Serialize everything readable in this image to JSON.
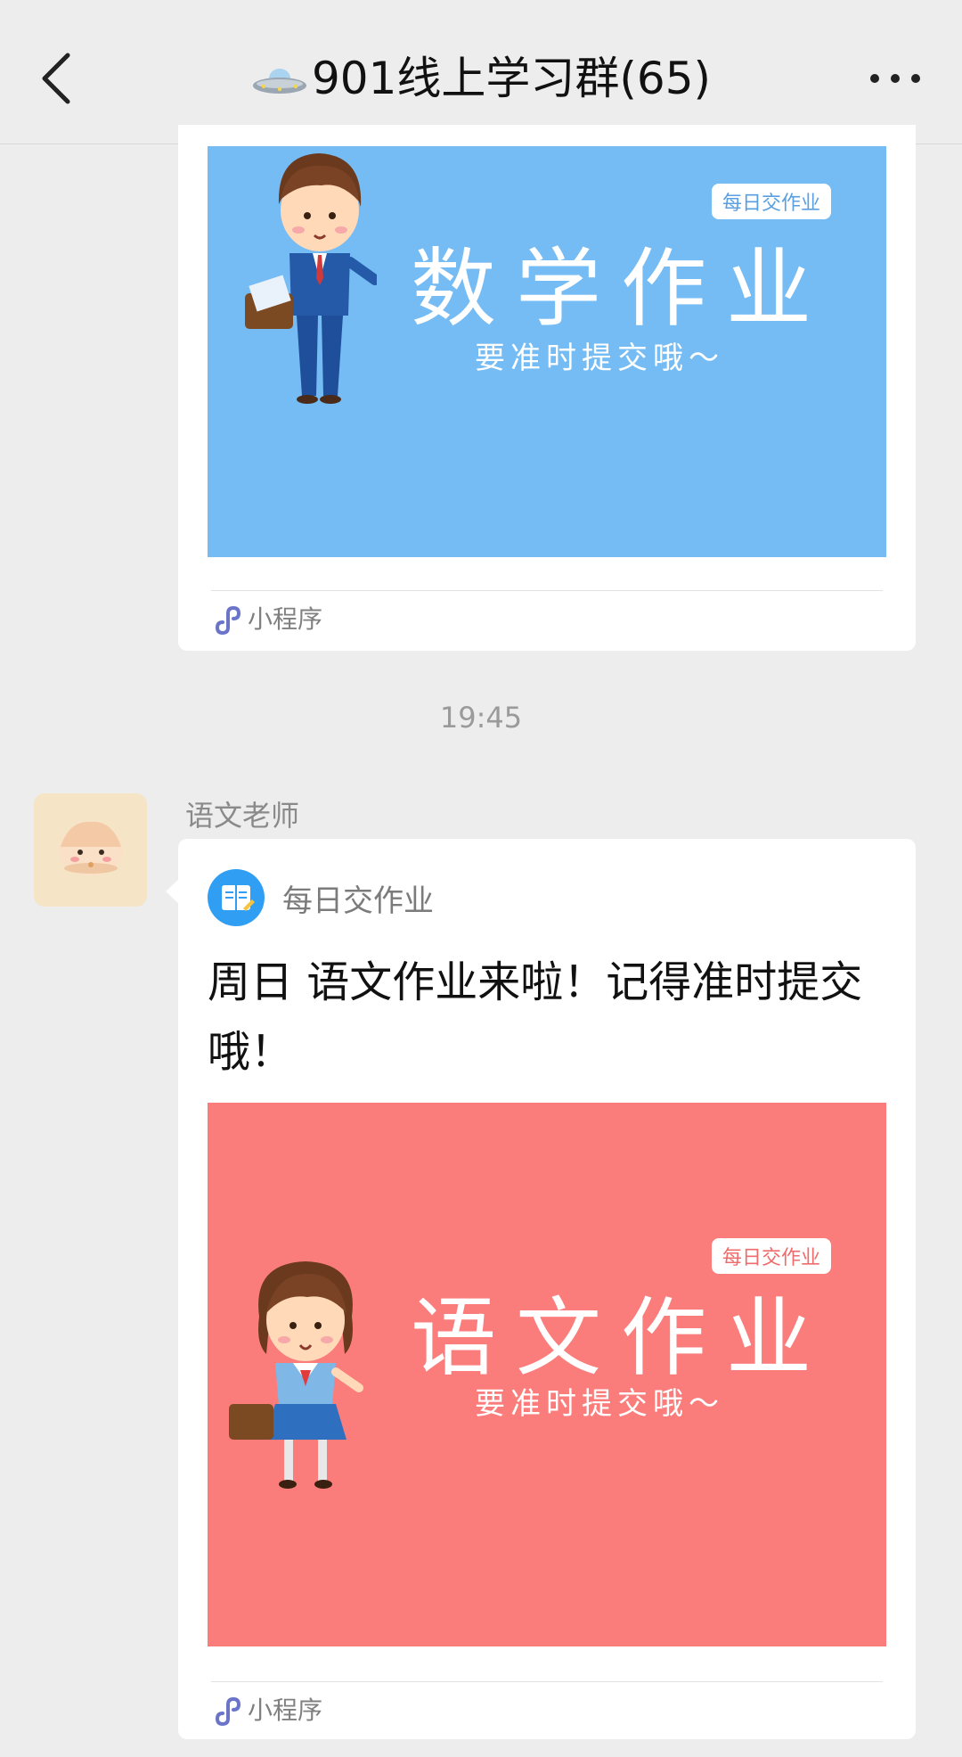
{
  "header": {
    "title": "901线上学习群(65)",
    "back_icon": "chevron-left-icon",
    "more_icon": "ellipsis-icon"
  },
  "messages": [
    {
      "type": "mini-program",
      "cover": {
        "badge": "每日交作业",
        "title": "数学作业",
        "subtitle": "要准时提交哦～",
        "bg_color": "#75bcf4"
      },
      "footer_label": "小程序"
    },
    {
      "type": "timestamp",
      "text": "19:45"
    },
    {
      "type": "mini-program",
      "sender": "语文老师",
      "app_name": "每日交作业",
      "text": "周日 语文作业来啦！记得准时提交哦！",
      "cover": {
        "badge": "每日交作业",
        "title": "语文作业",
        "subtitle": "要准时提交哦～",
        "bg_color": "#fb7d7b"
      },
      "footer_label": "小程序"
    }
  ],
  "colors": {
    "background": "#ededed",
    "card": "#ffffff",
    "mini_program_icon": "#6b74c8"
  }
}
